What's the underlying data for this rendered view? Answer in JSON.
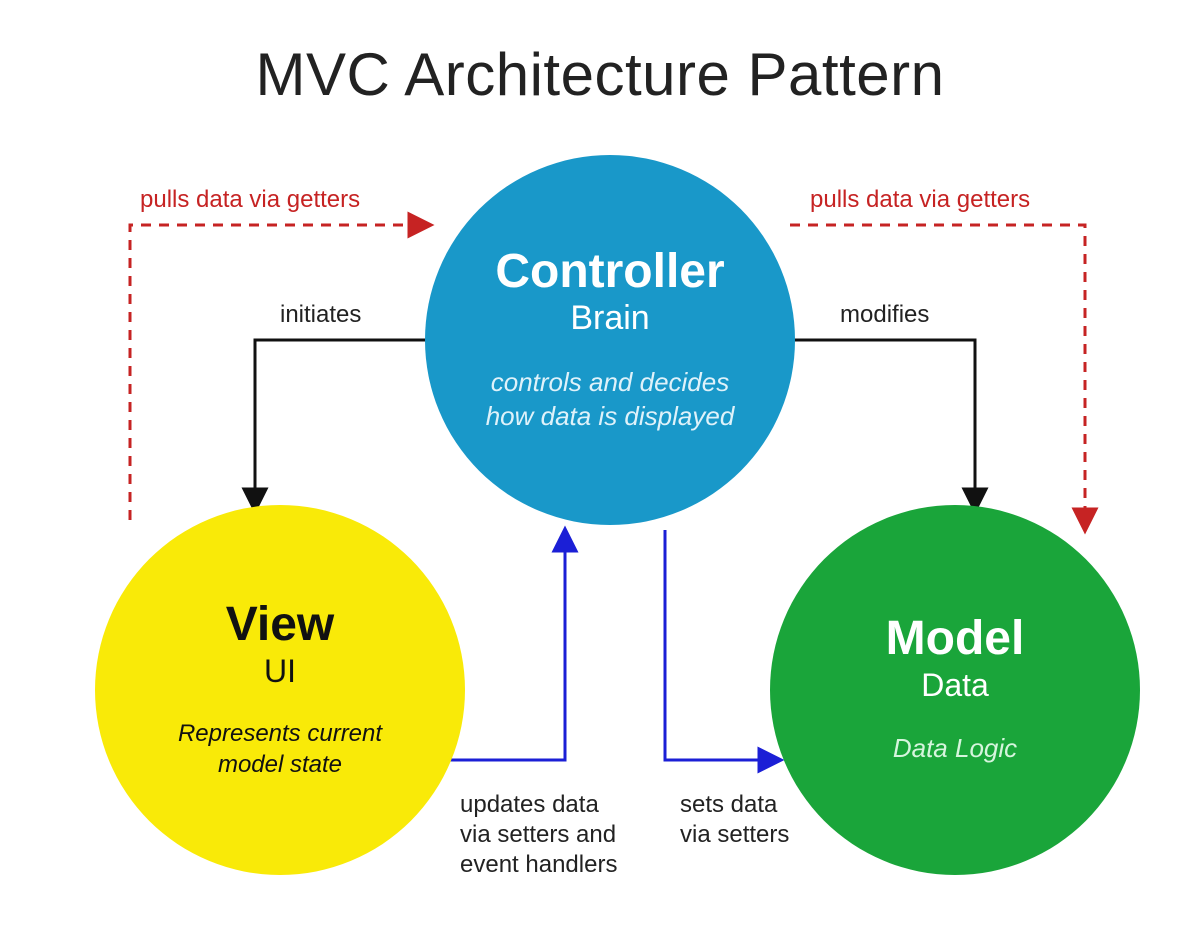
{
  "title": "MVC Architecture Pattern",
  "controller": {
    "head": "Controller",
    "sub": "Brain",
    "desc_line1": "controls and decides",
    "desc_line2": "how data is displayed"
  },
  "view": {
    "head": "View",
    "sub": "UI",
    "desc_line1": "Represents current",
    "desc_line2": "model state"
  },
  "model": {
    "head": "Model",
    "sub": "Data",
    "desc": "Data Logic"
  },
  "labels": {
    "pulls_left": "pulls data via getters",
    "pulls_right": "pulls data via getters",
    "initiates": "initiates",
    "modifies": "modifies",
    "updates": "updates data\nvia setters and\nevent handlers",
    "sets": "sets data\nvia setters"
  },
  "colors": {
    "controller": "#1998c9",
    "view": "#f9ea08",
    "model": "#1aa53a",
    "dashed_arrow": "#c62323",
    "solid_black": "#111111",
    "solid_blue": "#1b1fd6"
  }
}
